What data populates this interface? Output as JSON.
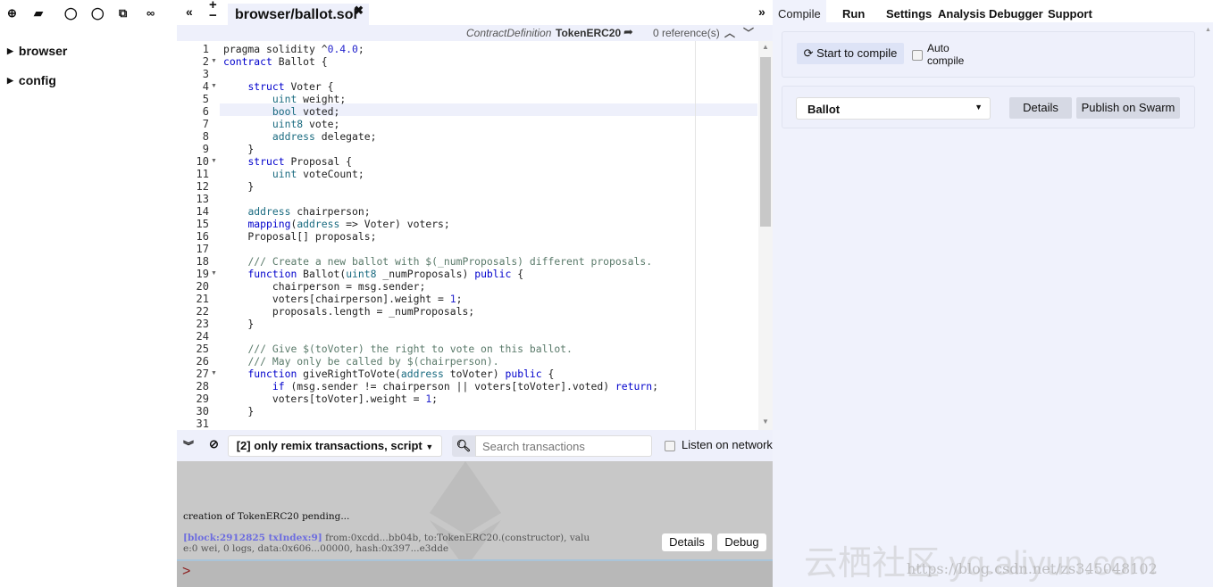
{
  "left": {
    "tree": [
      {
        "label": "browser"
      },
      {
        "label": "config"
      }
    ]
  },
  "editor": {
    "tab": "browser/ballot.sol",
    "ref": {
      "kind": "ContractDefinition",
      "name": "TokenERC20",
      "count": "0 reference(s)"
    },
    "lines": [
      [
        [
          "",
          "pragma solidity ^"
        ],
        [
          "nu",
          "0.4.0"
        ],
        [
          "",
          ";"
        ]
      ],
      [
        [
          "kw",
          "contract"
        ],
        [
          "",
          " Ballot {"
        ]
      ],
      [],
      [
        [
          "",
          "    "
        ],
        [
          "kw",
          "struct"
        ],
        [
          "",
          " Voter {"
        ]
      ],
      [
        [
          "",
          "        "
        ],
        [
          "ty",
          "uint"
        ],
        [
          "",
          " weight;"
        ]
      ],
      [
        [
          "",
          "        "
        ],
        [
          "ty",
          "bool"
        ],
        [
          "",
          " voted;"
        ]
      ],
      [
        [
          "",
          "        "
        ],
        [
          "ty",
          "uint8"
        ],
        [
          "",
          " vote;"
        ]
      ],
      [
        [
          "",
          "        "
        ],
        [
          "ty",
          "address"
        ],
        [
          "",
          " delegate;"
        ]
      ],
      [
        [
          "",
          "    }"
        ]
      ],
      [
        [
          "",
          "    "
        ],
        [
          "kw",
          "struct"
        ],
        [
          "",
          " Proposal {"
        ]
      ],
      [
        [
          "",
          "        "
        ],
        [
          "ty",
          "uint"
        ],
        [
          "",
          " voteCount;"
        ]
      ],
      [
        [
          "",
          "    }"
        ]
      ],
      [],
      [
        [
          "",
          "    "
        ],
        [
          "ty",
          "address"
        ],
        [
          "",
          " chairperson;"
        ]
      ],
      [
        [
          "",
          "    "
        ],
        [
          "kw",
          "mapping"
        ],
        [
          "",
          "("
        ],
        [
          "ty",
          "address"
        ],
        [
          "",
          " => Voter) voters;"
        ]
      ],
      [
        [
          "",
          "    Proposal[] proposals;"
        ]
      ],
      [],
      [
        [
          "",
          "    "
        ],
        [
          "cm",
          "/// Create a new ballot with $(_numProposals) different proposals."
        ]
      ],
      [
        [
          "",
          "    "
        ],
        [
          "kw",
          "function"
        ],
        [
          "",
          " Ballot("
        ],
        [
          "ty",
          "uint8"
        ],
        [
          "",
          " _numProposals) "
        ],
        [
          "kw",
          "public"
        ],
        [
          "",
          " {"
        ]
      ],
      [
        [
          "",
          "        chairperson = msg.sender;"
        ]
      ],
      [
        [
          "",
          "        voters[chairperson].weight = "
        ],
        [
          "nu",
          "1"
        ],
        [
          "",
          ";"
        ]
      ],
      [
        [
          "",
          "        proposals.length = _numProposals;"
        ]
      ],
      [
        [
          "",
          "    }"
        ]
      ],
      [],
      [
        [
          "",
          "    "
        ],
        [
          "cm",
          "/// Give $(toVoter) the right to vote on this ballot."
        ]
      ],
      [
        [
          "",
          "    "
        ],
        [
          "cm",
          "/// May only be called by $(chairperson)."
        ]
      ],
      [
        [
          "",
          "    "
        ],
        [
          "kw",
          "function"
        ],
        [
          "",
          " giveRightToVote("
        ],
        [
          "ty",
          "address"
        ],
        [
          "",
          " toVoter) "
        ],
        [
          "kw",
          "public"
        ],
        [
          "",
          " {"
        ]
      ],
      [
        [
          "",
          "        "
        ],
        [
          "kw",
          "if"
        ],
        [
          "",
          " (msg.sender != chairperson || voters[toVoter].voted) "
        ],
        [
          "kw",
          "return"
        ],
        [
          "",
          ";"
        ]
      ],
      [
        [
          "",
          "        voters[toVoter].weight = "
        ],
        [
          "nu",
          "1"
        ],
        [
          "",
          ";"
        ]
      ],
      [
        [
          "",
          "    }"
        ]
      ],
      []
    ],
    "folds": [
      2,
      4,
      10,
      19,
      27
    ]
  },
  "terminal": {
    "filter": "[2] only remix transactions, script",
    "search_placeholder": "Search transactions",
    "listen": "Listen on network",
    "pending": "creation of TokenERC20 pending...",
    "tx_tag": "[block:2912825 txIndex:9]",
    "tx_line1": " from:0xcdd...bb04b, to:TokenERC20.(constructor), valu",
    "tx_line2": "e:0 wei, 0 logs, data:0x606...00000, hash:0x397...e3dde",
    "details": "Details",
    "debug": "Debug",
    "prompt": ">"
  },
  "right": {
    "tabs": [
      "Compile",
      "Run",
      "Settings",
      "Analysis",
      "Debugger",
      "Support"
    ],
    "compile_btn": "Start to compile",
    "auto_compile_1": "Auto",
    "auto_compile_2": "compile",
    "contract": "Ballot",
    "details": "Details",
    "publish": "Publish on Swarm"
  },
  "watermark": {
    "main": "云栖社区 yq.aliyun.com",
    "url": "https://blog.csdn.net/zs345048102"
  }
}
